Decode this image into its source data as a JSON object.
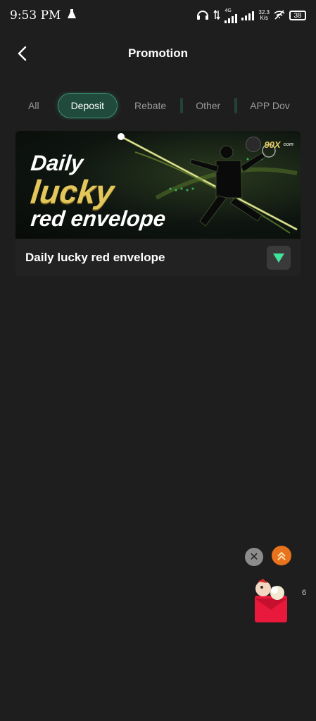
{
  "status_bar": {
    "time": "9:53 PM",
    "network_type": "4G",
    "net_speed_value": "32.3",
    "net_speed_unit": "K/s",
    "battery_level": "38",
    "icons": [
      "flask-icon",
      "headphones-icon",
      "data-arrows-icon",
      "signal-icon",
      "signal-icon",
      "wifi-off-icon",
      "battery-icon"
    ]
  },
  "header": {
    "title": "Promotion",
    "back_icon": "chevron-left-icon"
  },
  "tabs": [
    {
      "label": "All",
      "active": false
    },
    {
      "label": "Deposit",
      "active": true
    },
    {
      "label": "Rebate",
      "active": false
    },
    {
      "label": "Other",
      "active": false
    },
    {
      "label": "APP Dov",
      "active": false
    }
  ],
  "promotion_card": {
    "banner": {
      "line1": "Daily",
      "line2": "lucky",
      "line3": "red envelope",
      "brand": "90X",
      "brand_suffix": "com"
    },
    "title": "Daily lucky red envelope",
    "expand_icon": "triangle-down-icon"
  },
  "floating_widget": {
    "close_symbol": "✕",
    "scroll_top_icon": "double-chevron-up-icon",
    "envelope_icon": "red-envelope-icon",
    "edge_mark": "6"
  },
  "colors": {
    "background": "#1e1e1e",
    "accent": "#3f8f6f",
    "gold": "#e3c75b",
    "orange": "#e8731c"
  }
}
